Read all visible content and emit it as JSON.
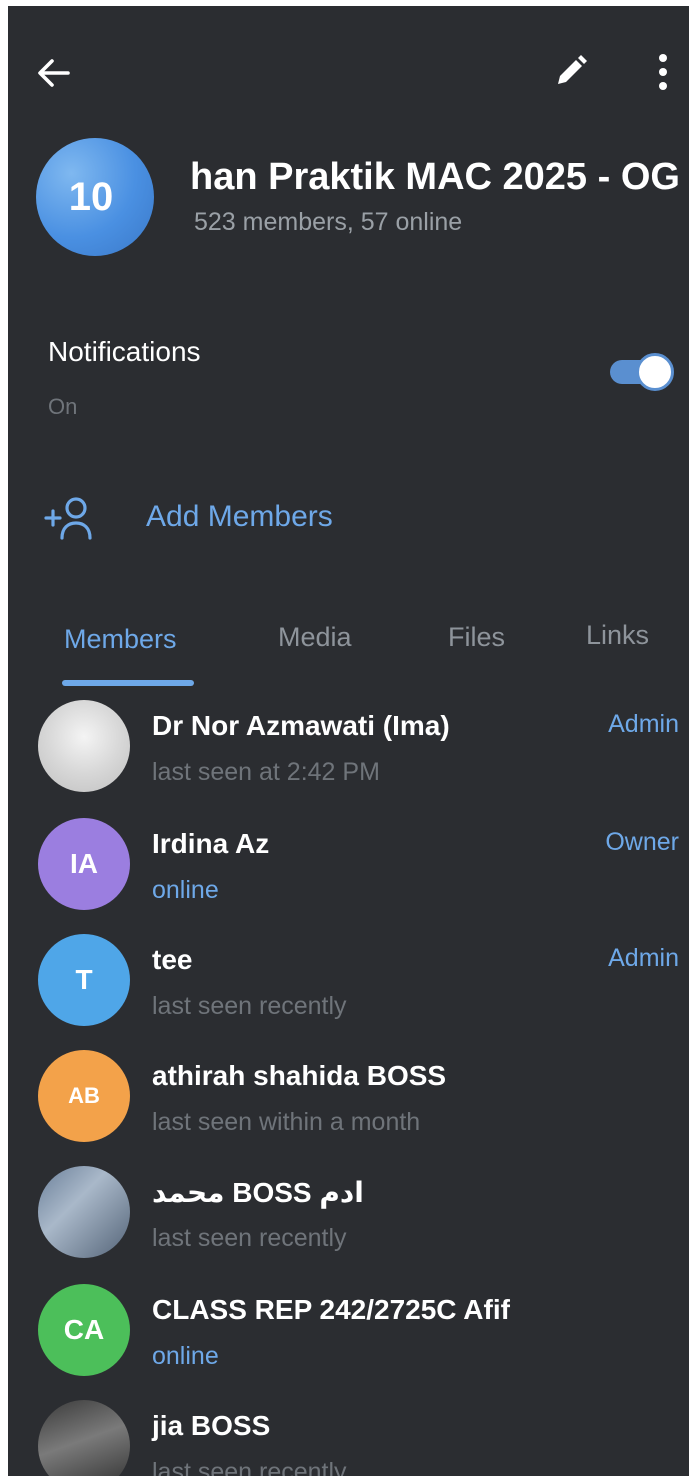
{
  "header": {
    "back_icon": "arrow-left-icon",
    "edit_icon": "pencil-icon",
    "more_icon": "more-vertical-icon"
  },
  "group": {
    "avatar_text": "10",
    "title": "han Praktik MAC 2025 - OG",
    "subtitle": "523 members, 57 online"
  },
  "notifications": {
    "label": "Notifications",
    "value": "On",
    "enabled": true
  },
  "add_members": {
    "icon": "add-person-icon",
    "label": "Add Members"
  },
  "tabs": [
    {
      "label": "Members",
      "active": true
    },
    {
      "label": "Media",
      "active": false
    },
    {
      "label": "Files",
      "active": false
    },
    {
      "label": "Links",
      "active": false
    }
  ],
  "members": [
    {
      "name": "Dr Nor Azmawati (Ima)",
      "status": "last seen at 2:42 PM",
      "role": "Admin",
      "avatar_type": "photo"
    },
    {
      "name": "Irdina Az",
      "status": "online",
      "role": "Owner",
      "avatar_text": "IA",
      "avatar_color": "#9b7ee0"
    },
    {
      "name": "tee",
      "status": "last seen recently",
      "role": "Admin",
      "avatar_text": "T",
      "avatar_color": "#4fa6e8"
    },
    {
      "name": "athirah shahida BOSS",
      "status": "last seen within a month",
      "role": "",
      "avatar_text": "AB",
      "avatar_color": "#f3a24a"
    },
    {
      "name": "محمد BOSS ادم",
      "status": "last seen recently",
      "role": "",
      "avatar_type": "photo"
    },
    {
      "name": "CLASS REP 242/2725C Afif",
      "status": "online",
      "role": "",
      "avatar_text": "CA",
      "avatar_color": "#4cbf5a"
    },
    {
      "name": "jia BOSS",
      "status": "last seen recently",
      "role": "",
      "avatar_type": "photo"
    }
  ],
  "colors": {
    "background": "#2b2d31",
    "accent": "#6ea8e8"
  }
}
